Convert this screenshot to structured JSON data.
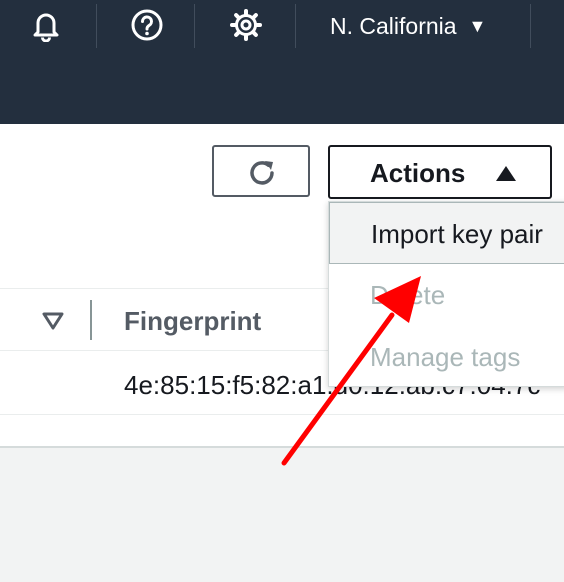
{
  "topbar": {
    "icons": [
      "bell-icon",
      "help-icon",
      "gear-icon"
    ],
    "region": "N. California",
    "background": "#232f3e"
  },
  "toolbar": {
    "refresh_icon": "refresh-icon",
    "actions_label": "Actions",
    "actions_caret": "caret-up-icon"
  },
  "actions_menu": {
    "items": [
      {
        "label": "Import key pair",
        "state": "highlighted"
      },
      {
        "label": "Delete",
        "state": "disabled"
      },
      {
        "label": "Manage tags",
        "state": "disabled"
      }
    ]
  },
  "table": {
    "columns": [
      "Fingerprint"
    ],
    "rows": [
      {
        "fingerprint": "4e:85:15:f5:82:a1:d0:12:ab:c7:04:7c"
      }
    ]
  },
  "colors": {
    "accent_arrow": "#ff0000",
    "disabled_text": "#aab7b8"
  }
}
